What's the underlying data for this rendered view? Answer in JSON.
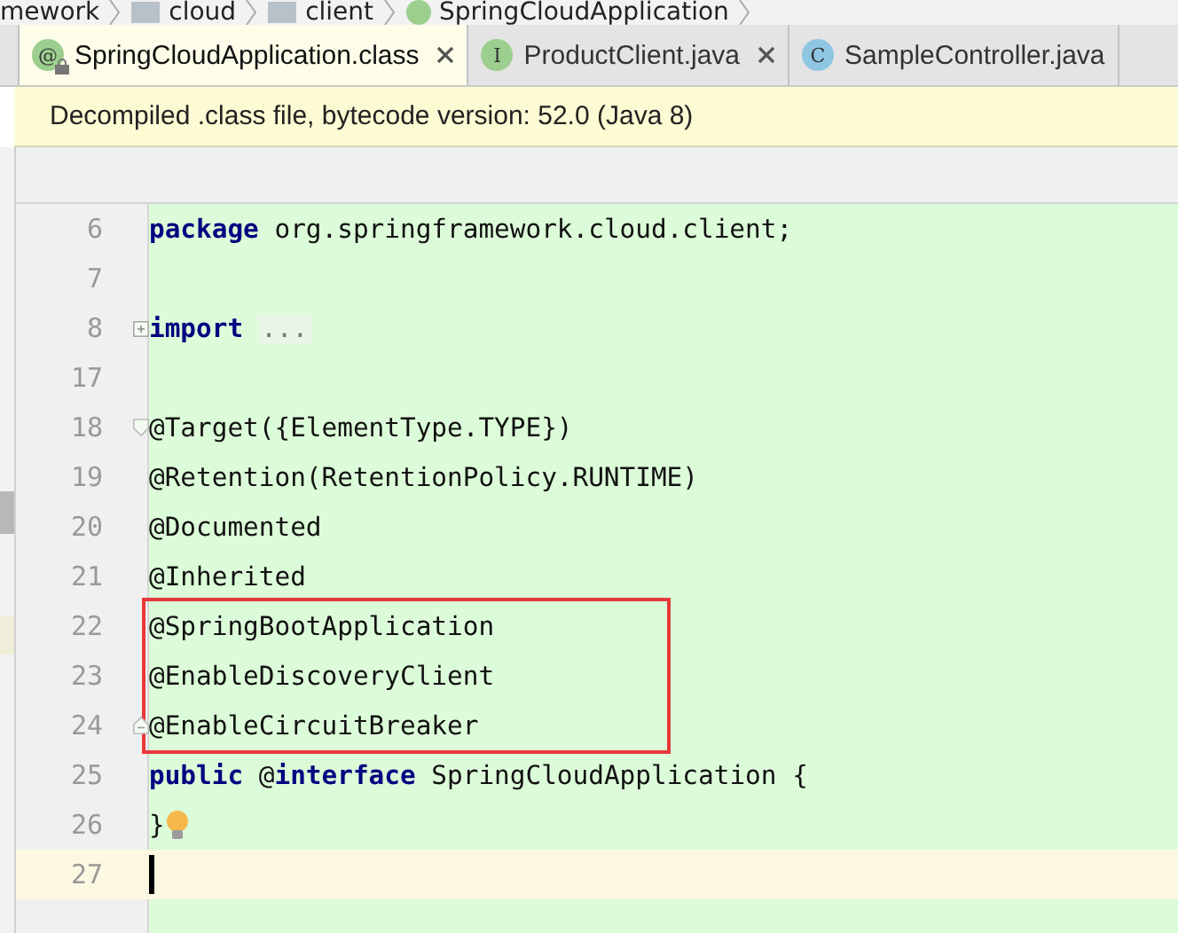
{
  "breadcrumbs": [
    {
      "label": "mework",
      "kind": "text"
    },
    {
      "label": "cloud",
      "kind": "folder"
    },
    {
      "label": "client",
      "kind": "folder"
    },
    {
      "label": "SpringCloudApplication",
      "kind": "annotation"
    }
  ],
  "tabs": [
    {
      "label": "SpringCloudApplication.class",
      "icon": "@",
      "kind": "annotation",
      "selected": true,
      "closable": true
    },
    {
      "label": "ProductClient.java",
      "icon": "I",
      "kind": "interface",
      "selected": false,
      "closable": true
    },
    {
      "label": "SampleController.java",
      "icon": "C",
      "kind": "class",
      "selected": false,
      "closable": false
    }
  ],
  "notice": "Decompiled .class file, bytecode version: 52.0 (Java 8)",
  "code": {
    "lines": [
      {
        "number": "6",
        "kind": "plain",
        "tokens": [
          {
            "text": "package",
            "kind": "keyword"
          },
          {
            "text": " org.springframework.cloud.client;",
            "kind": "plain"
          }
        ],
        "boxed": false,
        "current": false,
        "bulb": false
      },
      {
        "number": "7",
        "kind": "plain",
        "boxed": false,
        "current": false,
        "bulb": false
      },
      {
        "number": "8",
        "kind": "folded",
        "tokens": [
          {
            "text": "import",
            "kind": "keyword"
          },
          {
            "text": "...",
            "kind": "folded"
          }
        ],
        "boxed": false,
        "current": false,
        "bulb": false
      },
      {
        "number": "17",
        "kind": "plain",
        "boxed": false,
        "current": false,
        "bulb": false
      },
      {
        "number": "18",
        "kind": "fold-start",
        "tokens": [
          {
            "text": "@Target({ElementType.TYPE})",
            "kind": "plain"
          }
        ],
        "boxed": false,
        "current": false,
        "bulb": false
      },
      {
        "number": "19",
        "kind": "plain",
        "tokens": [
          {
            "text": "@Retention(RetentionPolicy.RUNTIME)",
            "kind": "plain"
          }
        ],
        "boxed": false,
        "current": false,
        "bulb": false
      },
      {
        "number": "20",
        "kind": "plain",
        "tokens": [
          {
            "text": "@Documented",
            "kind": "plain"
          }
        ],
        "boxed": false,
        "current": false,
        "bulb": false
      },
      {
        "number": "21",
        "kind": "plain",
        "tokens": [
          {
            "text": "@Inherited",
            "kind": "plain"
          }
        ],
        "boxed": false,
        "current": false,
        "bulb": false
      },
      {
        "number": "22",
        "kind": "plain",
        "tokens": [
          {
            "text": "@SpringBootApplication",
            "kind": "plain"
          }
        ],
        "boxed": true,
        "current": false,
        "bulb": false
      },
      {
        "number": "23",
        "kind": "plain",
        "tokens": [
          {
            "text": "@EnableDiscoveryClient",
            "kind": "plain"
          }
        ],
        "boxed": true,
        "current": false,
        "bulb": false
      },
      {
        "number": "24",
        "kind": "fold-end",
        "tokens": [
          {
            "text": "@EnableCircuitBreaker",
            "kind": "plain"
          }
        ],
        "boxed": true,
        "current": false,
        "bulb": false
      },
      {
        "number": "25",
        "kind": "plain",
        "tokens": [
          {
            "text": "public",
            "kind": "keyword"
          },
          {
            "text": " @",
            "kind": "plain"
          },
          {
            "text": "interface",
            "kind": "keyword"
          },
          {
            "text": " SpringCloudApplication {",
            "kind": "plain"
          }
        ],
        "boxed": false,
        "current": false,
        "bulb": false
      },
      {
        "number": "26",
        "kind": "plain",
        "tokens": [
          {
            "text": "}",
            "kind": "plain"
          }
        ],
        "boxed": false,
        "current": false,
        "bulb": true
      },
      {
        "number": "27",
        "kind": "plain",
        "boxed": false,
        "current": true,
        "bulb": false
      }
    ]
  }
}
